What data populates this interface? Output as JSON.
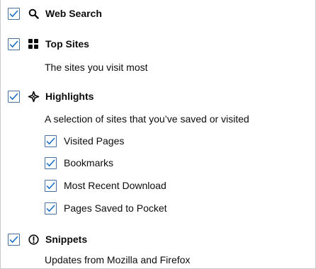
{
  "colors": {
    "checkbox_border": "#4a6f9c",
    "checkmark": "#1d6fc4",
    "text": "#0c0c0d",
    "frame_border": "#c9c9cd"
  },
  "sections": {
    "web_search": {
      "label": "Web Search",
      "checked": true,
      "icon": "search-icon"
    },
    "top_sites": {
      "label": "Top Sites",
      "description": "The sites you visit most",
      "checked": true,
      "icon": "grid-icon"
    },
    "highlights": {
      "label": "Highlights",
      "description": "A selection of sites that you’ve saved or visited",
      "checked": true,
      "icon": "sparkle-icon",
      "options": [
        {
          "label": "Visited Pages",
          "checked": true
        },
        {
          "label": "Bookmarks",
          "checked": true
        },
        {
          "label": "Most Recent Download",
          "checked": true
        },
        {
          "label": "Pages Saved to Pocket",
          "checked": true
        }
      ]
    },
    "snippets": {
      "label": "Snippets",
      "description": "Updates from Mozilla and Firefox",
      "checked": true,
      "icon": "info-icon"
    }
  }
}
